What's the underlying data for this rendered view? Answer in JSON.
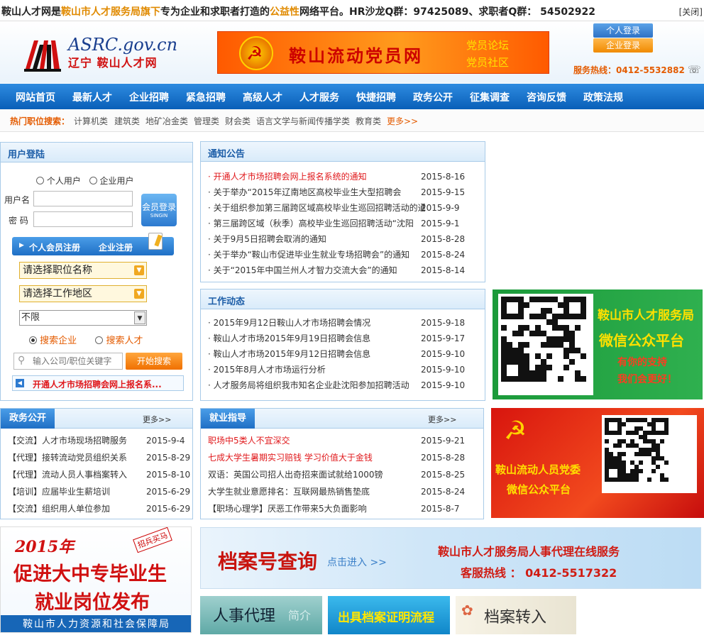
{
  "topbar": {
    "text_a": "鞍山人才网是",
    "text_b": "鞍山市人才服务局旗下",
    "text_c": "专为企业和求职者打造的",
    "text_d": "公益性",
    "text_e": "网络平台。HR沙龙Q群：97425089、求职者Q群：  54502922",
    "close": "[关闭]"
  },
  "header": {
    "logo_domain": "ASRC.gov.cn",
    "logo_tagline": "辽宁 鞍山人才网",
    "banner_title": "鞍山流动党员网",
    "banner_sub1": "党员论坛",
    "banner_sub2": "党员社区",
    "personal_login": "个人登录",
    "company_login": "企业登录",
    "hotline": "服务热线：0412-5532882",
    "phone_icon": "☏"
  },
  "nav": [
    "网站首页",
    "最新人才",
    "企业招聘",
    "紧急招聘",
    "高级人才",
    "人才服务",
    "快捷招聘",
    "政务公开",
    "征集调查",
    "咨询反馈",
    "政策法规"
  ],
  "hotjobs": {
    "label": "热门职位搜索：",
    "items": [
      "计算机类",
      "建筑类",
      "地矿冶金类",
      "管理类",
      "财会类",
      "语言文学与新闻传播学类",
      "教育类"
    ],
    "more": "更多>>"
  },
  "login": {
    "title": "用户登陆",
    "radio_personal": "个人用户",
    "radio_company": "企业用户",
    "username_label": "用户名",
    "password_label": "密  码",
    "submit_line1": "会员登录",
    "submit_line2": "SINGIN",
    "register_personal": "个人会员注册",
    "register_company": "企业注册",
    "select_position": "请选择职位名称",
    "select_area": "请选择工作地区",
    "select_limit": "不限",
    "search_company": "搜索企业",
    "search_talent": "搜索人才",
    "search_placeholder": "输入公司/职位关键字",
    "search_button": "开始搜索",
    "notice_link": "开通人才市场招聘会网上报名系..."
  },
  "notices": {
    "title": "通知公告",
    "items": [
      {
        "text": "开通人才市场招聘会网上报名系统的通知",
        "date": "2015-8-16",
        "hot": true
      },
      {
        "text": "关于举办“2015年辽南地区高校毕业生大型招聘会",
        "date": "2015-9-15"
      },
      {
        "text": "关于组织参加第三届跨区域高校毕业生巡回招聘活动的通知",
        "date": "2015-9-9"
      },
      {
        "text": "第三届跨区域（秋季）高校毕业生巡回招聘活动“沈阳",
        "date": "2015-9-1"
      },
      {
        "text": "关于9月5日招聘会取消的通知",
        "date": "2015-8-28"
      },
      {
        "text": "关于举办“鞍山市促进毕业生就业专场招聘会”的通知",
        "date": "2015-8-24"
      },
      {
        "text": "关于“2015年中国兰州人才智力交流大会”的通知",
        "date": "2015-8-14"
      }
    ]
  },
  "news": {
    "title": "工作动态",
    "items": [
      {
        "text": "2015年9月12日鞍山人才市场招聘会情况",
        "date": "2015-9-18"
      },
      {
        "text": "鞍山人才市场2015年9月19日招聘会信息",
        "date": "2015-9-17"
      },
      {
        "text": "鞍山人才市场2015年9月12日招聘会信息",
        "date": "2015-9-10"
      },
      {
        "text": "2015年8月人才市场运行分析",
        "date": "2015-9-10"
      },
      {
        "text": "人才服务局将组织我市知名企业赴沈阳参加招聘活动",
        "date": "2015-9-10"
      }
    ]
  },
  "gov": {
    "title": "政务公开",
    "more": "更多>>",
    "items": [
      {
        "text": "【交流】人才市场现场招聘服务",
        "date": "2015-9-4"
      },
      {
        "text": "【代理】接转流动党员组织关系",
        "date": "2015-8-29"
      },
      {
        "text": "【代理】流动人员人事档案转入",
        "date": "2015-8-10"
      },
      {
        "text": "【培训】应届毕业生薪培训",
        "date": "2015-6-29"
      },
      {
        "text": "【交流】组织用人单位参加",
        "date": "2015-6-29"
      }
    ]
  },
  "jobs": {
    "title": "就业指导",
    "more": "更多>>",
    "items": [
      {
        "text": "职场中5类人不宜深交",
        "date": "2015-9-21",
        "hot": true
      },
      {
        "text": "七成大学生暑期实习赔钱 学习价值大于金钱",
        "date": "2015-8-28",
        "hot": true
      },
      {
        "text": "双语：英国公司招人出奇招来面试就给1000镑",
        "date": "2015-8-25"
      },
      {
        "text": "大学生就业意愿排名：互联网最热销售垫底",
        "date": "2015-8-24"
      },
      {
        "text": "【职场心理学】厌恶工作带来5大负面影响",
        "date": "2015-8-7"
      }
    ]
  },
  "wechat1": {
    "line1": "鞍山市人才服务局",
    "line2": "微信公众平台",
    "line3": "有你的支持",
    "line4": "我们会更好！"
  },
  "wechat2": {
    "line1": "鞍山流动人员党委",
    "line2": "微信公众平台"
  },
  "promo": {
    "year": "2015年",
    "line1": "促进大中专毕业生",
    "line2": "就业岗位发布",
    "stamp": "招兵买马",
    "footer": "鞍山市人力资源和社会保障局"
  },
  "archive": {
    "title": "档案号查询",
    "click": "点击进入 >>",
    "service": "鞍山市人才服务局人事代理在线服务",
    "phone": "客服热线 ： 0412-5517322"
  },
  "tiles": {
    "agent": "人事代理",
    "agent_sub": "简介",
    "proof": "出具档案证明流程",
    "transfer": "档案转入"
  }
}
